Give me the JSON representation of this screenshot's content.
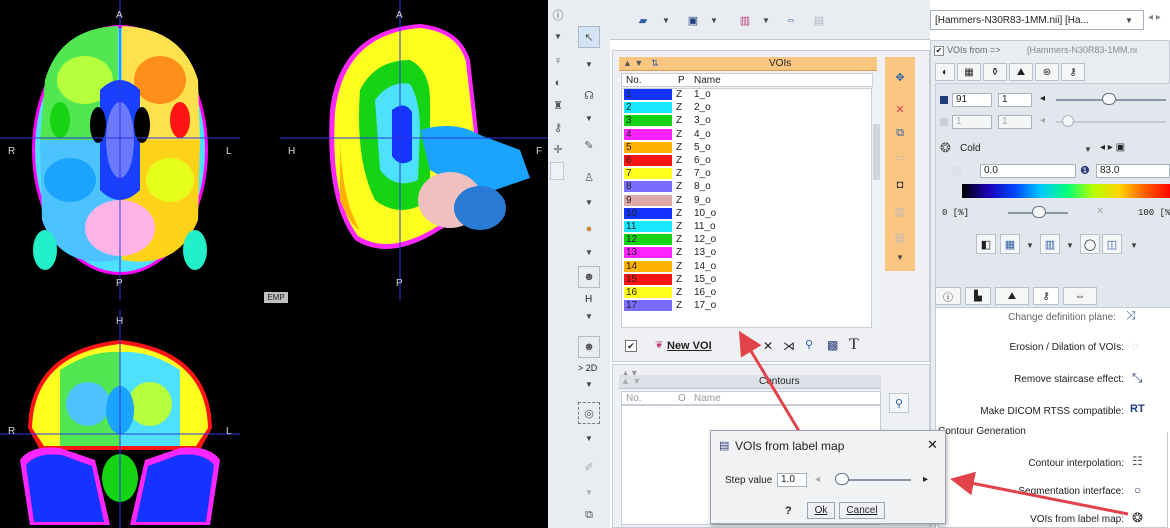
{
  "viewer": {
    "axial": {
      "top": "A",
      "bottom": "P",
      "left": "R",
      "right": "L"
    },
    "sagittal": {
      "top": "A",
      "bottom": "P",
      "left": "H",
      "right": "F"
    },
    "coronal": {
      "top": "H",
      "left": "R",
      "right": "L"
    },
    "emp_label": "EMP"
  },
  "left_toolbar": {
    "label_h": "H",
    "label_2d": "> 2D"
  },
  "top_toolbar": {
    "dataset": "[Hammers-N30R83-1MM.nii] [Ha..."
  },
  "voi_panel": {
    "header": "VOIs",
    "columns": [
      "No.",
      "P",
      "Name"
    ],
    "rows": [
      {
        "no": "1",
        "p": "Z",
        "name": "1_o",
        "color": "#1533ff"
      },
      {
        "no": "2",
        "p": "Z",
        "name": "2_o",
        "color": "#19e6ff"
      },
      {
        "no": "3",
        "p": "Z",
        "name": "3_o",
        "color": "#14d414"
      },
      {
        "no": "4",
        "p": "Z",
        "name": "4_o",
        "color": "#ff24ff"
      },
      {
        "no": "5",
        "p": "Z",
        "name": "5_o",
        "color": "#ffb300"
      },
      {
        "no": "6",
        "p": "Z",
        "name": "6_o",
        "color": "#ff1414"
      },
      {
        "no": "7",
        "p": "Z",
        "name": "7_o",
        "color": "#ffff1f"
      },
      {
        "no": "8",
        "p": "Z",
        "name": "8_o",
        "color": "#7a6cff"
      },
      {
        "no": "9",
        "p": "Z",
        "name": "9_o",
        "color": "#e0a9a9"
      },
      {
        "no": "10",
        "p": "Z",
        "name": "10_o",
        "color": "#1533ff"
      },
      {
        "no": "11",
        "p": "Z",
        "name": "11_o",
        "color": "#19e6ff"
      },
      {
        "no": "12",
        "p": "Z",
        "name": "12_o",
        "color": "#14d414"
      },
      {
        "no": "13",
        "p": "Z",
        "name": "13_o",
        "color": "#ff24ff"
      },
      {
        "no": "14",
        "p": "Z",
        "name": "14_o",
        "color": "#ffb300"
      },
      {
        "no": "15",
        "p": "Z",
        "name": "15_o",
        "color": "#ff1414"
      },
      {
        "no": "16",
        "p": "Z",
        "name": "16_o",
        "color": "#ffff1f"
      },
      {
        "no": "17",
        "p": "Z",
        "name": "17_o",
        "color": "#7a6cff"
      }
    ],
    "new_voi": "New VOI"
  },
  "contours_panel": {
    "header": "Contours",
    "columns": [
      "No.",
      "O",
      "Name"
    ]
  },
  "right_panel": {
    "vois_from": "VOIs from =>",
    "vois_from_value": "[Hammers-N30R83-1MM.ni",
    "value_1": "91",
    "value_2": "1",
    "value_3": "1",
    "value_4": "1",
    "colormap": "Cold",
    "min_value": "0.0",
    "max_value": "83.0",
    "range_min": "0 [%]",
    "range_max": "100 [%]",
    "partial_text": "Change definition plane:",
    "erosion": "Erosion / Dilation of VOIs:",
    "staircase": "Remove staircase effect:",
    "dicom": "Make DICOM RTSS compatible:",
    "dicom_icon": "RT",
    "contour_generation": "Contour Generation",
    "interpolation": "Contour interpolation:",
    "segmentation": "Segmentation interface:",
    "label_map": "VOIs from label map:"
  },
  "dialog": {
    "title": "VOIs from label map",
    "step_label": "Step value",
    "step_value": "1.0",
    "help": "?",
    "ok": "Ok",
    "cancel": "Cancel"
  },
  "colors": {
    "accent_orange": "#fbc582",
    "arrow": "#e2434a",
    "viewer_bg": "#000000"
  }
}
